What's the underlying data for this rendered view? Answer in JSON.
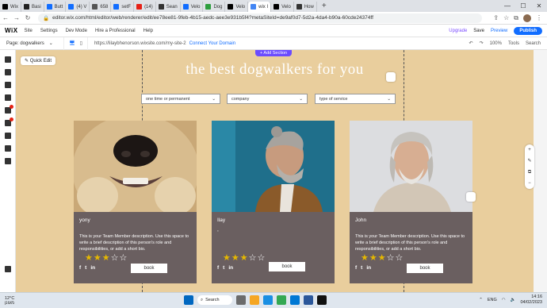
{
  "browser": {
    "tabs": [
      {
        "label": "Wix",
        "color": "#000000"
      },
      {
        "label": "Basi",
        "color": "#222222"
      },
      {
        "label": "Butt",
        "color": "#116dff"
      },
      {
        "label": "(4) V",
        "color": "#116dff"
      },
      {
        "label": "658",
        "color": "#555555"
      },
      {
        "label": "setF",
        "color": "#116dff"
      },
      {
        "label": "(14)",
        "color": "#e62117"
      },
      {
        "label": "Sean",
        "color": "#333333"
      },
      {
        "label": "Velo",
        "color": "#116dff"
      },
      {
        "label": "Dog",
        "color": "#2e9e3f"
      },
      {
        "label": "Velo",
        "color": "#000000"
      },
      {
        "label": "wix I",
        "color": "#4285f4"
      },
      {
        "label": "Velo",
        "color": "#000000"
      },
      {
        "label": "How",
        "color": "#333333"
      }
    ],
    "new_tab": "+",
    "url": "editor.wix.com/html/editor/web/renderer/edit/ee78ee81-9feb-4b15-aedc-aee3e931b5f4?metaSiteId=de9af0d7-5d2a-4da4-b90a-60cde24374ff"
  },
  "wix": {
    "logo": "WiX",
    "menu": [
      "Site",
      "Settings",
      "Dev Mode",
      "Hire a Professional",
      "Help"
    ],
    "upgrade": "Upgrade",
    "save": "Save",
    "preview": "Preview",
    "publish": "Publish",
    "page_label": "Page: dogwalkers",
    "site_url": "https://lilaybhenorson.wixsite.com/my-site-2",
    "connect_domain": "Connect Your Domain",
    "zoom": "100%",
    "tools": "Tools",
    "search": "Search",
    "quick_edit": "Quick Edit",
    "add_section": "+ Add Section"
  },
  "page": {
    "headline": "the best dogwalkers for you",
    "filters": [
      "one time or permanent",
      "company",
      "type of service"
    ],
    "book_label": "book",
    "social": [
      "f",
      "t",
      "in"
    ],
    "description": "This is your Team Member description. Use this space to write a brief description of this person's role and responsibilities, or add a short bio.",
    "members": [
      {
        "name": "yony",
        "rating": 3,
        "has_desc": true
      },
      {
        "name": "Ilay",
        "sub": ",",
        "rating": 3,
        "has_desc": false
      },
      {
        "name": "John",
        "rating": 3,
        "has_desc": true
      }
    ]
  },
  "taskbar": {
    "temp": "12°C",
    "weather": "מעונן",
    "search": "Search",
    "lang": "ENG",
    "time": "14:16",
    "date": "04/02/2023",
    "accent": "#0067c0"
  }
}
